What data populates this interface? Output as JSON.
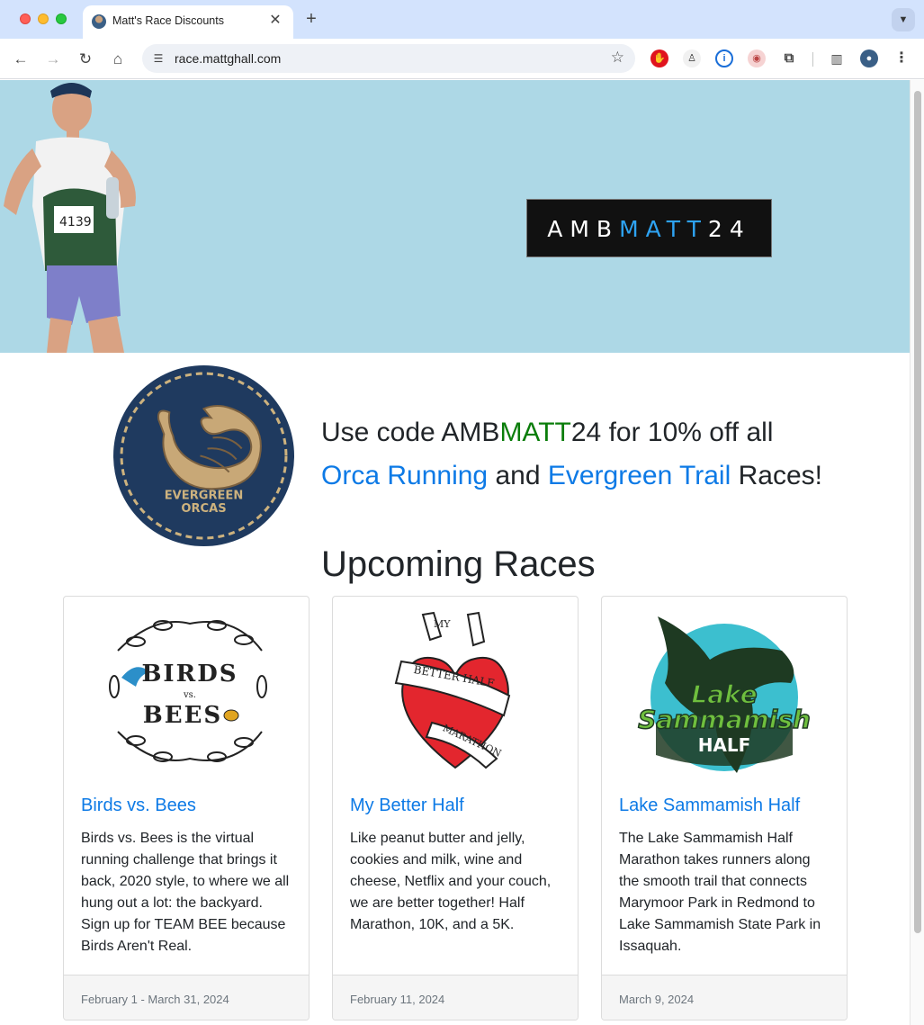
{
  "browser": {
    "tab_title": "Matt's Race Discounts",
    "tab_close": "✕",
    "new_tab": "+",
    "url": "race.mattghall.com"
  },
  "hero": {
    "code_part1": "AMB",
    "code_part2": "MATT",
    "code_part3": "24",
    "code_color": "#2ea3f2",
    "background": "#add8e6"
  },
  "orca_logo": {
    "line1": "EVERGREEN",
    "line2": "ORCAS"
  },
  "promo": {
    "prefix": "Use code AMB",
    "code_green": "MATT",
    "suffix": "24 for 10% off all",
    "link1": "Orca Running",
    "and": " and ",
    "link2": "Evergreen Trail",
    "end": " Races!"
  },
  "section_title": "Upcoming Races",
  "cards": [
    {
      "title": "Birds vs. Bees",
      "text": "Birds vs. Bees is the virtual running challenge that brings it back, 2020 style, to where we all hung out a lot: the backyard. Sign up for TEAM BEE because Birds Aren't Real.",
      "date": "February 1 - March 31, 2024",
      "logo_line1": "BIRDS",
      "logo_line2": "vs.",
      "logo_line3": "BEES"
    },
    {
      "title": "My Better Half",
      "text": "Like peanut butter and jelly, cookies and milk, wine and cheese, Netflix and your couch, we are better together! Half Marathon, 10K, and a 5K.",
      "date": "February 11, 2024",
      "logo_line1": "MY",
      "logo_line2": "BETTER HALF",
      "logo_line3": "MARATHON"
    },
    {
      "title": "Lake Sammamish Half",
      "text": "The Lake Sammamish Half Marathon takes runners along the smooth trail that connects Marymoor Park in Redmond to Lake Sammamish State Park in Issaquah.",
      "date": "March 9, 2024",
      "logo_line1": "Lake",
      "logo_line2": "Sammamish",
      "logo_line3": "HALF"
    }
  ]
}
